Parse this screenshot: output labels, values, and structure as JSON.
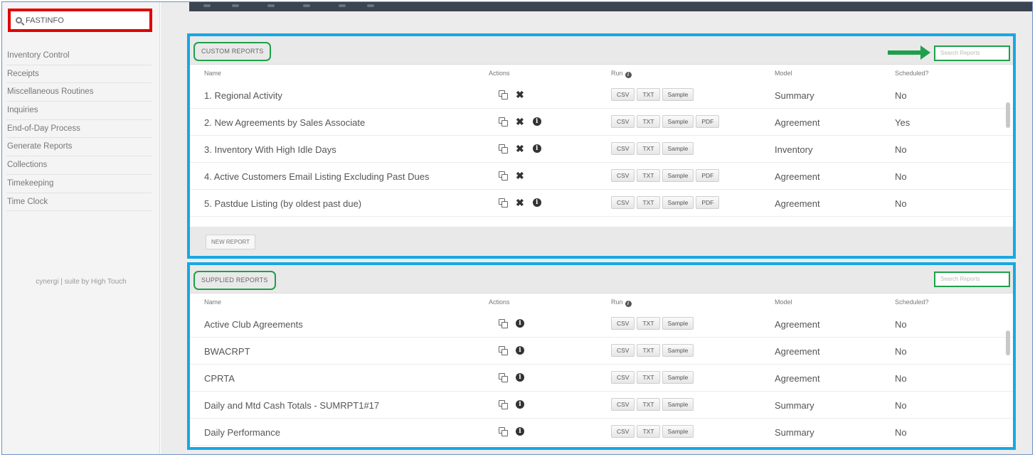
{
  "sidebar": {
    "search_label": "FASTINFO",
    "items": [
      "Inventory Control",
      "Receipts",
      "Miscellaneous Routines",
      "Inquiries",
      "End-of-Day Process",
      "Generate Reports",
      "Collections",
      "Timekeeping",
      "Time Clock"
    ],
    "credit": "cynergi | suite by High Touch"
  },
  "columns": {
    "name": "Name",
    "actions": "Actions",
    "run": "Run",
    "model": "Model",
    "scheduled": "Scheduled?"
  },
  "custom_reports": {
    "title": "CUSTOM REPORTS",
    "search_placeholder": "Search Reports",
    "new_report_label": "NEW REPORT",
    "rows": [
      {
        "name": "1. Regional Activity",
        "actions": [
          "copy-icon",
          "delete-icon"
        ],
        "run": [
          "CSV",
          "TXT",
          "Sample"
        ],
        "model": "Summary",
        "scheduled": "No"
      },
      {
        "name": "2. New Agreements by Sales Associate",
        "actions": [
          "copy-icon",
          "delete-icon",
          "info-icon"
        ],
        "run": [
          "CSV",
          "TXT",
          "Sample",
          "PDF"
        ],
        "model": "Agreement",
        "scheduled": "Yes"
      },
      {
        "name": "3. Inventory With High Idle Days",
        "actions": [
          "copy-icon",
          "delete-icon",
          "info-icon"
        ],
        "run": [
          "CSV",
          "TXT",
          "Sample"
        ],
        "model": "Inventory",
        "scheduled": "No"
      },
      {
        "name": "4. Active Customers Email Listing Excluding Past Dues",
        "actions": [
          "copy-icon",
          "delete-icon"
        ],
        "run": [
          "CSV",
          "TXT",
          "Sample",
          "PDF"
        ],
        "model": "Agreement",
        "scheduled": "No"
      },
      {
        "name": "5. Pastdue Listing (by oldest past due)",
        "actions": [
          "copy-icon",
          "delete-icon",
          "info-icon"
        ],
        "run": [
          "CSV",
          "TXT",
          "Sample",
          "PDF"
        ],
        "model": "Agreement",
        "scheduled": "No"
      }
    ]
  },
  "supplied_reports": {
    "title": "SUPPLIED REPORTS",
    "search_placeholder": "Search Reports",
    "rows": [
      {
        "name": "Active Club Agreements",
        "actions": [
          "copy-icon",
          "info-icon"
        ],
        "run": [
          "CSV",
          "TXT",
          "Sample"
        ],
        "model": "Agreement",
        "scheduled": "No"
      },
      {
        "name": "BWACRPT",
        "actions": [
          "copy-icon",
          "info-icon"
        ],
        "run": [
          "CSV",
          "TXT",
          "Sample"
        ],
        "model": "Agreement",
        "scheduled": "No"
      },
      {
        "name": "CPRTA",
        "actions": [
          "copy-icon",
          "info-icon"
        ],
        "run": [
          "CSV",
          "TXT",
          "Sample"
        ],
        "model": "Agreement",
        "scheduled": "No"
      },
      {
        "name": "Daily and Mtd Cash Totals - SUMRPT1#17",
        "actions": [
          "copy-icon",
          "info-icon"
        ],
        "run": [
          "CSV",
          "TXT",
          "Sample"
        ],
        "model": "Summary",
        "scheduled": "No"
      },
      {
        "name": "Daily Performance",
        "actions": [
          "copy-icon",
          "info-icon"
        ],
        "run": [
          "CSV",
          "TXT",
          "Sample"
        ],
        "model": "Summary",
        "scheduled": "No"
      }
    ]
  },
  "colors": {
    "highlight_red": "#e00000",
    "highlight_blue": "#17a8e3",
    "highlight_green": "#1fa04a"
  }
}
